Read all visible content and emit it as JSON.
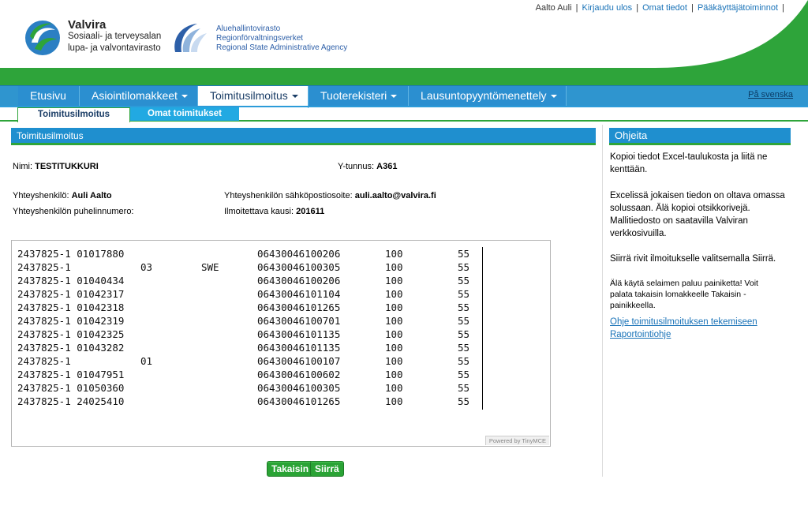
{
  "header": {
    "user_name": "Aalto Auli",
    "links": [
      "Kirjaudu ulos",
      "Omat tiedot",
      "Pääkäyttäjätoiminnot"
    ],
    "valvira_title": "Valvira",
    "valvira_sub1": "Sosiaali- ja terveysalan",
    "valvira_sub2": "lupa- ja valvontavirasto",
    "avi_line1": "Aluehallintovirasto",
    "avi_line2": "Regionförvaltningsverket",
    "avi_line3": "Regional State Administrative Agency",
    "green": "#2ea43a"
  },
  "nav": {
    "items": [
      "Etusivu",
      "Asiointilomakkeet",
      "Toimitusilmoitus",
      "Tuoterekisteri",
      "Lausuntopyyntömenettely"
    ],
    "lang_link": "På svenska"
  },
  "subtabs": {
    "active": "Toimitusilmoitus",
    "inactive": "Omat toimitukset"
  },
  "main": {
    "title": "Toimitusilmoitus",
    "nimi_label": "Nimi:",
    "nimi_value": "TESTITUKKURI",
    "ytunnus_label": "Y-tunnus:",
    "ytunnus_value": "A361",
    "contact_label": "Yhteyshenkilö:",
    "contact_value": "Auli Aalto",
    "email_label": "Yhteyshenkilön sähköpostiosoite:",
    "email_value": "auli.aalto@valvira.fi",
    "phone_label": "Yhteyshenkilön puhelinnumero:",
    "period_label": "Ilmoitettava kausi:",
    "period_value": "201611",
    "editor_rows": [
      [
        "2437825-1 01017880",
        "",
        "",
        "06430046100206",
        "100",
        "55"
      ],
      [
        "2437825-1",
        "03",
        "SWE",
        "06430046100305",
        "100",
        "55"
      ],
      [
        "2437825-1 01040434",
        "",
        "",
        "06430046100206",
        "100",
        "55"
      ],
      [
        "2437825-1 01042317",
        "",
        "",
        "06430046101104",
        "100",
        "55"
      ],
      [
        "2437825-1 01042318",
        "",
        "",
        "06430046101265",
        "100",
        "55"
      ],
      [
        "2437825-1 01042319",
        "",
        "",
        "06430046100701",
        "100",
        "55"
      ],
      [
        "2437825-1 01042325",
        "",
        "",
        "06430046101135",
        "100",
        "55"
      ],
      [
        "2437825-1 01043282",
        "",
        "",
        "06430046101135",
        "100",
        "55"
      ],
      [
        "2437825-1",
        "01",
        "",
        "06430046100107",
        "100",
        "55"
      ],
      [
        "2437825-1 01047951",
        "",
        "",
        "06430046100602",
        "100",
        "55"
      ],
      [
        "2437825-1 01050360",
        "",
        "",
        "06430046100305",
        "100",
        "55"
      ],
      [
        "2437825-1 24025410",
        "",
        "",
        "06430046101265",
        "100",
        "55"
      ]
    ],
    "powered_by": "Powered by TinyMCE",
    "back_button": "Takaisin",
    "move_button": "Siirrä"
  },
  "sidebar": {
    "title": "Ohjeita",
    "p1": "Kopioi tiedot Excel-taulukosta ja liitä ne kenttään.",
    "p2": "Excelissä jokaisen tiedon on oltava omassa solussaan. Älä kopioi otsikkorivejä. Mallitiedosto on saatavilla Valviran verkkosivuilla.",
    "p3": "Siirrä rivit ilmoitukselle valitsemalla Siirrä.",
    "p4": "Älä käytä selaimen paluu painiketta! Voit palata takaisin lomakkeelle Takaisin -painikkeella.",
    "link1": "Ohje toimitusilmoituksen tekemiseen",
    "link2": "Raportointiohje"
  }
}
